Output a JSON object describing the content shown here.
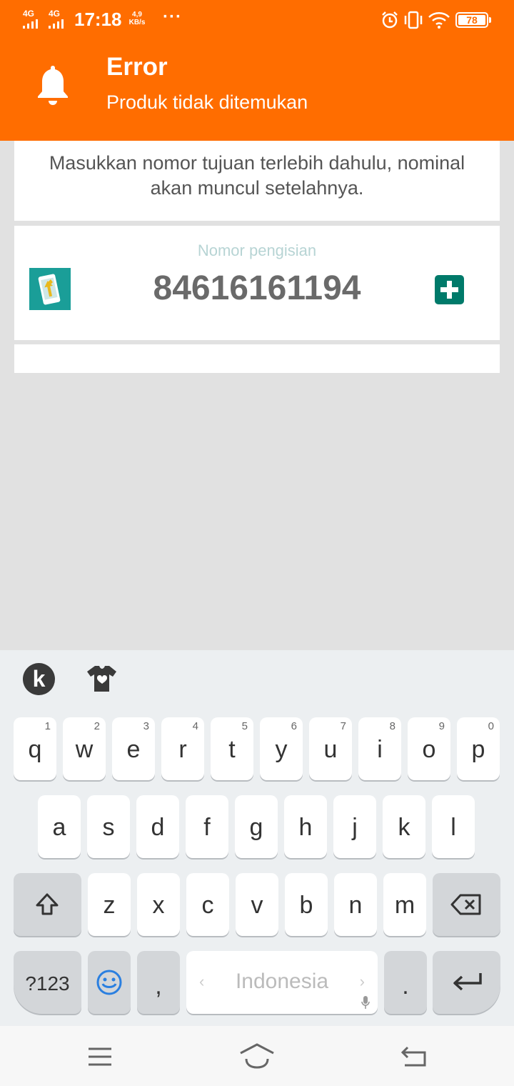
{
  "status_bar": {
    "network1": "4G",
    "network2": "4G",
    "time": "17:18",
    "speed_value": "4,9",
    "speed_unit": "KB/s",
    "more": "···",
    "battery": "78"
  },
  "notification": {
    "title": "Error",
    "message": "Produk tidak ditemukan",
    "icon": "bell-icon"
  },
  "info_text": "Masukkan nomor tujuan terlebih dahulu, nominal akan muncul setelahnya.",
  "number_field": {
    "label": "Nomor pengisian",
    "value": "84616161194"
  },
  "keyboard": {
    "row1": [
      {
        "key": "q",
        "num": "1"
      },
      {
        "key": "w",
        "num": "2"
      },
      {
        "key": "e",
        "num": "3"
      },
      {
        "key": "r",
        "num": "4"
      },
      {
        "key": "t",
        "num": "5"
      },
      {
        "key": "y",
        "num": "6"
      },
      {
        "key": "u",
        "num": "7"
      },
      {
        "key": "i",
        "num": "8"
      },
      {
        "key": "o",
        "num": "9"
      },
      {
        "key": "p",
        "num": "0"
      }
    ],
    "row2": [
      "a",
      "s",
      "d",
      "f",
      "g",
      "h",
      "j",
      "k",
      "l"
    ],
    "row3": [
      "z",
      "x",
      "c",
      "v",
      "b",
      "n",
      "m"
    ],
    "symbols_key": "?123",
    "comma_key": ",",
    "space_label": "Indonesia",
    "period_key": ".",
    "logo": "k"
  },
  "colors": {
    "header": "#ff6d00",
    "accent": "#007a6a"
  }
}
